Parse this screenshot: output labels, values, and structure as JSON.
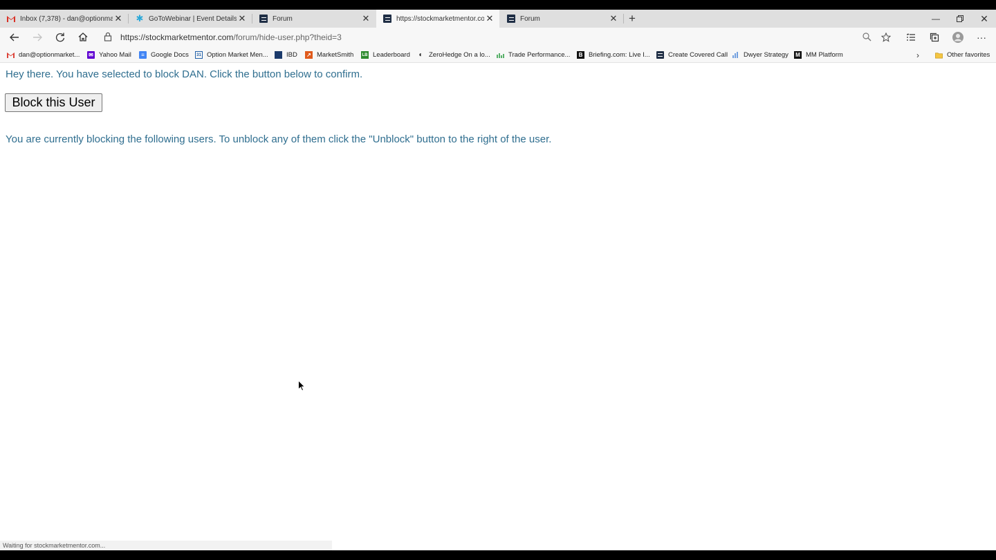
{
  "tabs": [
    {
      "title": "Inbox (7,378) - dan@optionmar",
      "icon": "gmail-icon",
      "active": false
    },
    {
      "title": "GoToWebinar | Event Details",
      "icon": "gotowebinar-icon",
      "active": false
    },
    {
      "title": "Forum",
      "icon": "smm-icon",
      "active": false
    },
    {
      "title": "https://stockmarketmentor.com",
      "icon": "smm-icon",
      "active": true
    },
    {
      "title": "Forum",
      "icon": "smm-icon",
      "active": false
    }
  ],
  "address_bar": {
    "url_host": "https://stockmarketmentor.com",
    "url_path": "/forum/hide-user.php?theid=3"
  },
  "bookmarks": [
    {
      "label": "dan@optionmarket...",
      "icon": "gmail-icon"
    },
    {
      "label": "Yahoo Mail",
      "icon": "yahoo-mail-icon"
    },
    {
      "label": "Google Docs",
      "icon": "google-docs-icon"
    },
    {
      "label": "Option Market Men...",
      "icon": "calendar-icon"
    },
    {
      "label": "IBD",
      "icon": "ibd-icon"
    },
    {
      "label": "MarketSmith",
      "icon": "marketsmith-icon"
    },
    {
      "label": "Leaderboard",
      "icon": "leaderboard-icon"
    },
    {
      "label": "ZeroHedge On a lo...",
      "icon": "zerohedge-icon"
    },
    {
      "label": "Trade Performance...",
      "icon": "chart-icon"
    },
    {
      "label": "Briefing.com: Live I...",
      "icon": "briefing-icon"
    },
    {
      "label": "Create Covered Call",
      "icon": "smm-icon"
    },
    {
      "label": "Dwyer Strategy",
      "icon": "bar-chart-icon"
    },
    {
      "label": "MM Platform",
      "icon": "mm-icon"
    }
  ],
  "other_favorites": "Other favorites",
  "page": {
    "confirm_message": "Hey there. You have selected to block DAN. Click the button below to confirm.",
    "block_button": "Block this User",
    "blocking_message": "You are currently blocking the following users. To unblock any of them click the \"Unblock\" button to the right of the user."
  },
  "status_text": "Waiting for stockmarketmentor.com..."
}
